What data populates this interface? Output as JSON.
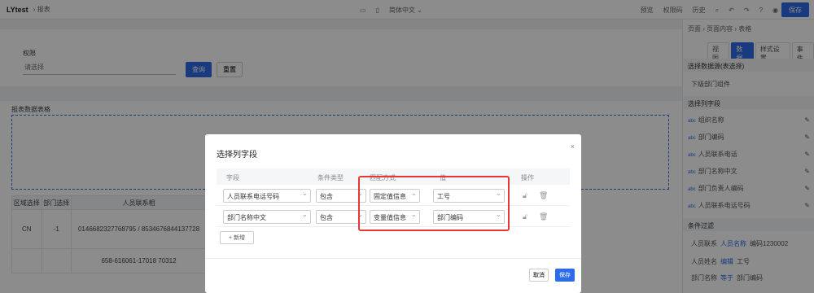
{
  "topbar": {
    "title": "LYtest",
    "crumb": "报表",
    "lang": "简体中文",
    "actions": [
      "预览",
      "权限码",
      "历史"
    ],
    "save": "保存"
  },
  "filter": {
    "label": "权限",
    "placeholder": "请选择",
    "query": "查询",
    "reset": "重置"
  },
  "report": {
    "title": "报表数据表格",
    "headers": [
      "区域选择",
      "部门选择",
      "人员联系相"
    ],
    "rows": [
      [
        "CN",
        "-1",
        "0146682327768795 / 8534676844137728"
      ],
      [
        "",
        "",
        "658-616061-17018 70312"
      ]
    ]
  },
  "right_panel": {
    "crumb": "页面 › 页面内容 › 表格",
    "tabs": [
      "视图",
      "数据",
      "样式设置",
      "事件"
    ],
    "source_title": "选择数据源(表选择)",
    "source_value": "下级部门组件",
    "fields_title": "选择列字段",
    "fields": [
      "组织名称",
      "部门编码",
      "人员联系电话",
      "部门名称中文",
      "部门负责人编码",
      "人员联系电话号码"
    ],
    "cond_title": "条件过滤",
    "conds": [
      [
        "人员联系",
        "人员名称",
        "编码1230002"
      ],
      [
        "人员姓名",
        "编辑",
        "工号"
      ],
      [
        "部门名称",
        "等于",
        "部门编码"
      ]
    ]
  },
  "modal": {
    "title": "选择列字段",
    "close": "×",
    "headers": [
      "字段",
      "条件类型",
      "匹配方式",
      "值",
      "操作"
    ],
    "rows": [
      {
        "field": "人员联系电话号码",
        "type": "包含",
        "match": "固定值信息",
        "value": "工号"
      },
      {
        "field": "部门名称中文",
        "type": "包含",
        "match": "变量值信息",
        "value": "部门编码"
      }
    ],
    "add": "+ 新增",
    "cancel": "取消",
    "ok": "保存"
  }
}
